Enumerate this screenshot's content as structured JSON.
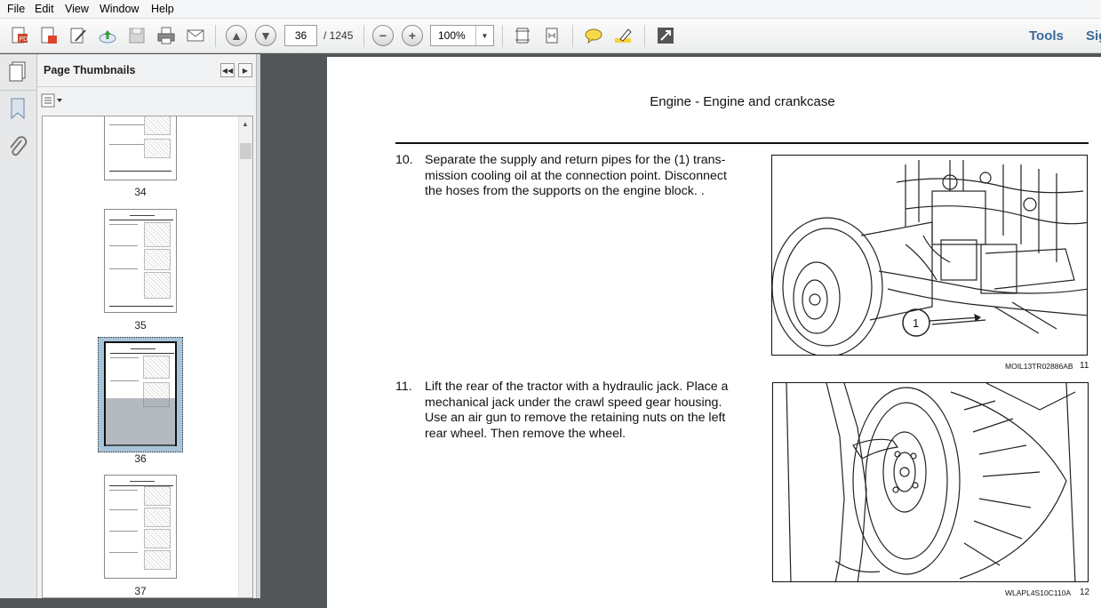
{
  "menubar": {
    "items": [
      "File",
      "Edit",
      "View",
      "Window",
      "Help"
    ]
  },
  "toolbar": {
    "page_current": "36",
    "page_total": "/ 1245",
    "zoom": "100%",
    "tools_label": "Tools",
    "sign_label": "Sign"
  },
  "panel": {
    "title": "Page Thumbnails",
    "thumbnails": [
      {
        "label": "34"
      },
      {
        "label": "35"
      },
      {
        "label": "36",
        "selected": true
      },
      {
        "label": "37"
      }
    ]
  },
  "document": {
    "header": "Engine - Engine and crankcase",
    "steps": [
      {
        "number": "10.",
        "lines": [
          "Separate the supply and return pipes for the (1) trans-",
          "mission cooling oil at the connection point. Disconnect",
          "the hoses from the supports on the engine block. ."
        ],
        "figure_callout": "1",
        "figure_code": "MOIL13TR02886AB",
        "figure_number": "11"
      },
      {
        "number": "11.",
        "lines": [
          "Lift the rear of the tractor with a hydraulic jack. Place a",
          "mechanical jack under the crawl speed gear housing.",
          "Use an air gun to remove the retaining nuts on the left",
          "rear wheel. Then remove the wheel."
        ],
        "figure_code": "WLAPL4S10C110A",
        "figure_number": "12"
      }
    ]
  },
  "icons": [
    "create-pdf-icon",
    "convert-icon",
    "edit-icon",
    "upload-icon",
    "save-icon",
    "print-icon",
    "email-icon",
    "page-up-icon",
    "page-down-icon",
    "zoom-out-icon",
    "zoom-in-icon",
    "fit-page-icon",
    "fit-width-icon",
    "comment-icon",
    "highlight-icon",
    "fullscreen-icon",
    "page-thumbnails-icon",
    "bookmark-icon",
    "attachment-icon"
  ]
}
